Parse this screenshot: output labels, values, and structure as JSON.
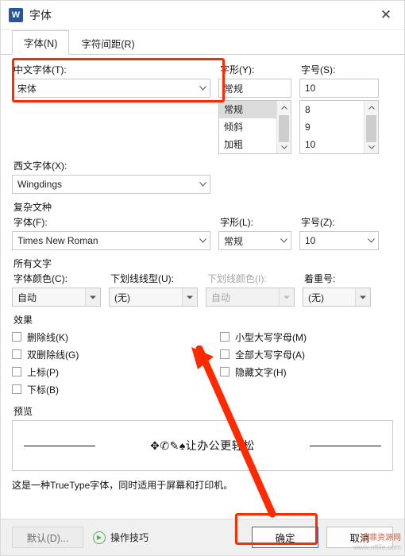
{
  "window": {
    "title": "字体",
    "app_icon_letter": "W",
    "close_icon": "✕"
  },
  "tabs": [
    {
      "label": "字体(N)",
      "active": true,
      "name": "tab-font"
    },
    {
      "label": "字符间距(R)",
      "active": false,
      "name": "tab-character-spacing"
    }
  ],
  "groups": {
    "chinese_font_label": "中文字体(T):",
    "western_font_label": "西文字体(X):",
    "complex_script_label": "复杂文种",
    "complex_font_label": "字体(F):",
    "complex_style_label": "字形(L):",
    "complex_size_label": "字号(Z):",
    "all_text_label": "所有文字",
    "font_style_label": "字形(Y):",
    "font_size_label": "字号(S):",
    "effects_label": "效果",
    "preview_label": "预览"
  },
  "fields": {
    "chinese_font": "宋体",
    "western_font": "Wingdings",
    "font_style": "常规",
    "font_size": "10",
    "style_list": [
      "常规",
      "倾斜",
      "加粗"
    ],
    "style_selected": "常规",
    "size_list": [
      "8",
      "9",
      "10"
    ],
    "size_selected": "10",
    "complex_font": "Times New Roman",
    "complex_style": "常规",
    "complex_size": "10",
    "font_color_label": "字体颜色(C):",
    "font_color": "自动",
    "underline_style_label": "下划线线型(U):",
    "underline_style": "(无)",
    "underline_color_label": "下划线颜色(I):",
    "underline_color": "自动",
    "emphasis_label": "着重号:",
    "emphasis": "(无)"
  },
  "effects": {
    "left": [
      {
        "label": "删除线(K)",
        "checked": false,
        "name": "checkbox-strikethrough"
      },
      {
        "label": "双删除线(G)",
        "checked": false,
        "name": "checkbox-double-strikethrough"
      },
      {
        "label": "上标(P)",
        "checked": false,
        "name": "checkbox-superscript"
      },
      {
        "label": "下标(B)",
        "checked": false,
        "name": "checkbox-subscript"
      }
    ],
    "right": [
      {
        "label": "小型大写字母(M)",
        "checked": false,
        "name": "checkbox-small-caps"
      },
      {
        "label": "全部大写字母(A)",
        "checked": false,
        "name": "checkbox-all-caps"
      },
      {
        "label": "隐藏文字(H)",
        "checked": false,
        "name": "checkbox-hidden-text"
      }
    ]
  },
  "preview": {
    "text": "✥✆✎♠让办公更轻松"
  },
  "note": "这是一种TrueType字体，同时适用于屏幕和打印机。",
  "footer": {
    "default_button": "默认(D)...",
    "tip_link": "操作技巧",
    "ok_button": "确定",
    "cancel_button": "取消"
  },
  "watermark": {
    "line1": "欧菲资源网",
    "line2": "www.offile.com"
  }
}
